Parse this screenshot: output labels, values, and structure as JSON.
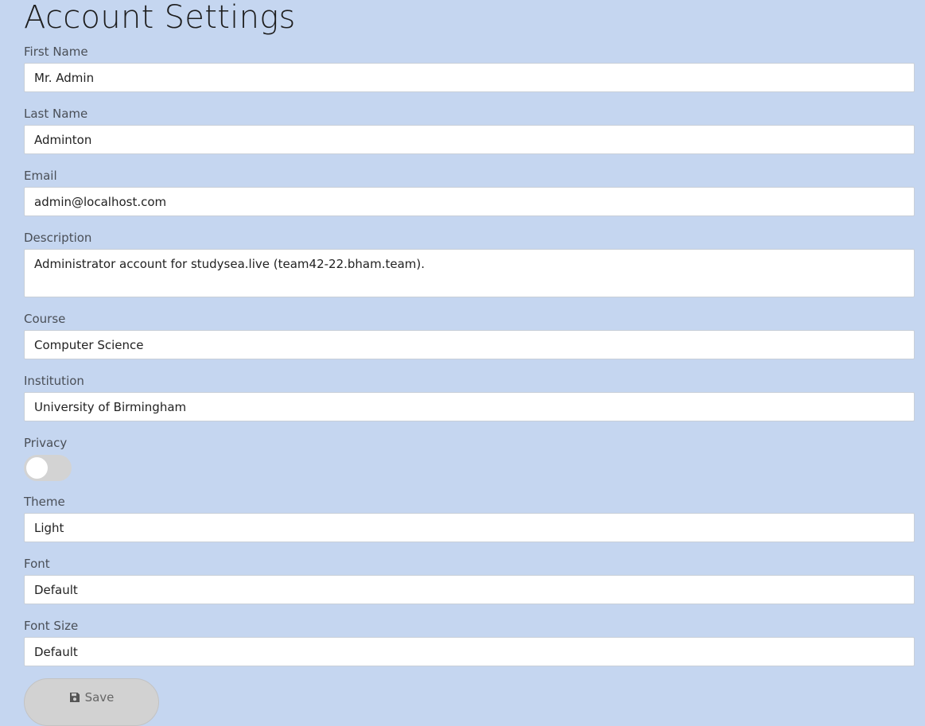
{
  "page": {
    "title": "Account Settings"
  },
  "fields": {
    "first_name": {
      "label": "First Name",
      "value": "Mr. Admin"
    },
    "last_name": {
      "label": "Last Name",
      "value": "Adminton"
    },
    "email": {
      "label": "Email",
      "value": "admin@localhost.com"
    },
    "description": {
      "label": "Description",
      "value": "Administrator account for studysea.live (team42-22.bham.team)."
    },
    "course": {
      "label": "Course",
      "value": "Computer Science"
    },
    "institution": {
      "label": "Institution",
      "value": "University of Birmingham"
    },
    "privacy": {
      "label": "Privacy",
      "enabled": false
    },
    "theme": {
      "label": "Theme",
      "value": "Light"
    },
    "font": {
      "label": "Font",
      "value": "Default"
    },
    "font_size": {
      "label": "Font Size",
      "value": "Default"
    }
  },
  "actions": {
    "save_label": "Save",
    "save_icon": "floppy-disk-icon"
  },
  "colors": {
    "background": "#c5d6f0",
    "input_bg": "#ffffff",
    "toggle_off": "#d3d3d3",
    "button_bg": "#d2d2d2"
  }
}
